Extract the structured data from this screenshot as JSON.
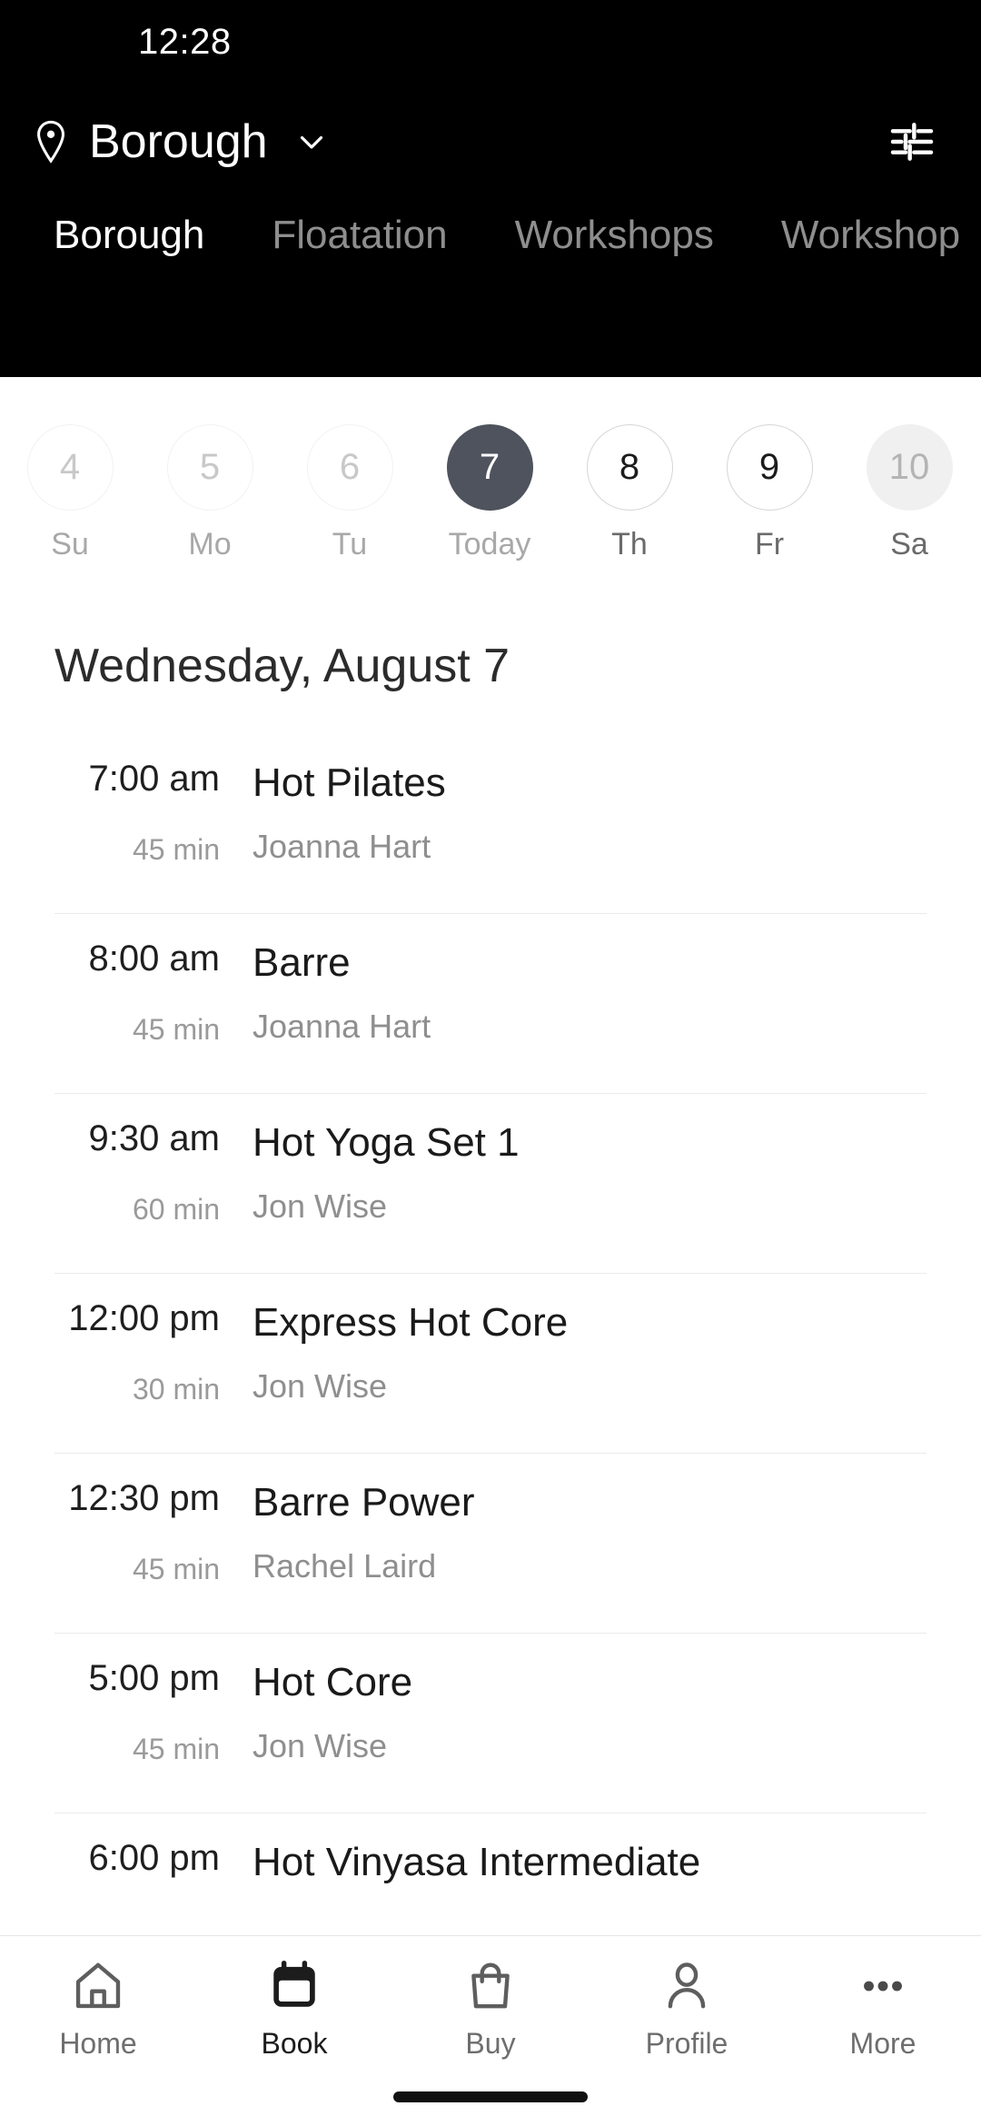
{
  "status_bar": {
    "time": "12:28"
  },
  "header": {
    "location_name": "Borough",
    "location_icon": "map-pin-icon",
    "dropdown_icon": "chevron-down-icon",
    "filter_icon": "sliders-filter-icon",
    "background_color": "#000000"
  },
  "tabs": [
    {
      "label": "Borough",
      "active": true
    },
    {
      "label": "Floatation",
      "active": false
    },
    {
      "label": "Workshops",
      "active": false
    },
    {
      "label": "Workshop",
      "active": false
    }
  ],
  "date_strip": [
    {
      "day_number": "4",
      "weekday": "Su",
      "state": "past"
    },
    {
      "day_number": "5",
      "weekday": "Mo",
      "state": "past"
    },
    {
      "day_number": "6",
      "weekday": "Tu",
      "state": "past"
    },
    {
      "day_number": "7",
      "weekday": "Today",
      "state": "selected"
    },
    {
      "day_number": "8",
      "weekday": "Th",
      "state": "available"
    },
    {
      "day_number": "9",
      "weekday": "Fr",
      "state": "available"
    },
    {
      "day_number": "10",
      "weekday": "Sa",
      "state": "highlight"
    }
  ],
  "selected_date_title": "Wednesday, August 7",
  "classes": [
    {
      "time": "7:00 am",
      "duration": "45 min",
      "name": "Hot Pilates",
      "instructor": "Joanna Hart"
    },
    {
      "time": "8:00 am",
      "duration": "45 min",
      "name": "Barre",
      "instructor": "Joanna Hart"
    },
    {
      "time": "9:30 am",
      "duration": "60 min",
      "name": "Hot Yoga Set 1",
      "instructor": "Jon Wise"
    },
    {
      "time": "12:00 pm",
      "duration": "30 min",
      "name": "Express Hot Core",
      "instructor": "Jon Wise"
    },
    {
      "time": "12:30 pm",
      "duration": "45 min",
      "name": "Barre Power",
      "instructor": "Rachel Laird"
    },
    {
      "time": "5:00 pm",
      "duration": "45 min",
      "name": "Hot Core",
      "instructor": "Jon Wise"
    },
    {
      "time": "6:00 pm",
      "duration": "",
      "name": "Hot Vinyasa Intermediate",
      "instructor": ""
    }
  ],
  "bottom_nav": [
    {
      "label": "Home",
      "icon": "home-icon",
      "active": false
    },
    {
      "label": "Book",
      "icon": "calendar-icon",
      "active": true
    },
    {
      "label": "Buy",
      "icon": "shopping-bag-icon",
      "active": false
    },
    {
      "label": "Profile",
      "icon": "person-icon",
      "active": false
    },
    {
      "label": "More",
      "icon": "ellipsis-icon",
      "active": false
    }
  ],
  "colors": {
    "header_bg": "#000000",
    "selected_day": "#4e535d",
    "text_primary": "#1a1a1a",
    "text_muted": "#8f8f8f"
  }
}
